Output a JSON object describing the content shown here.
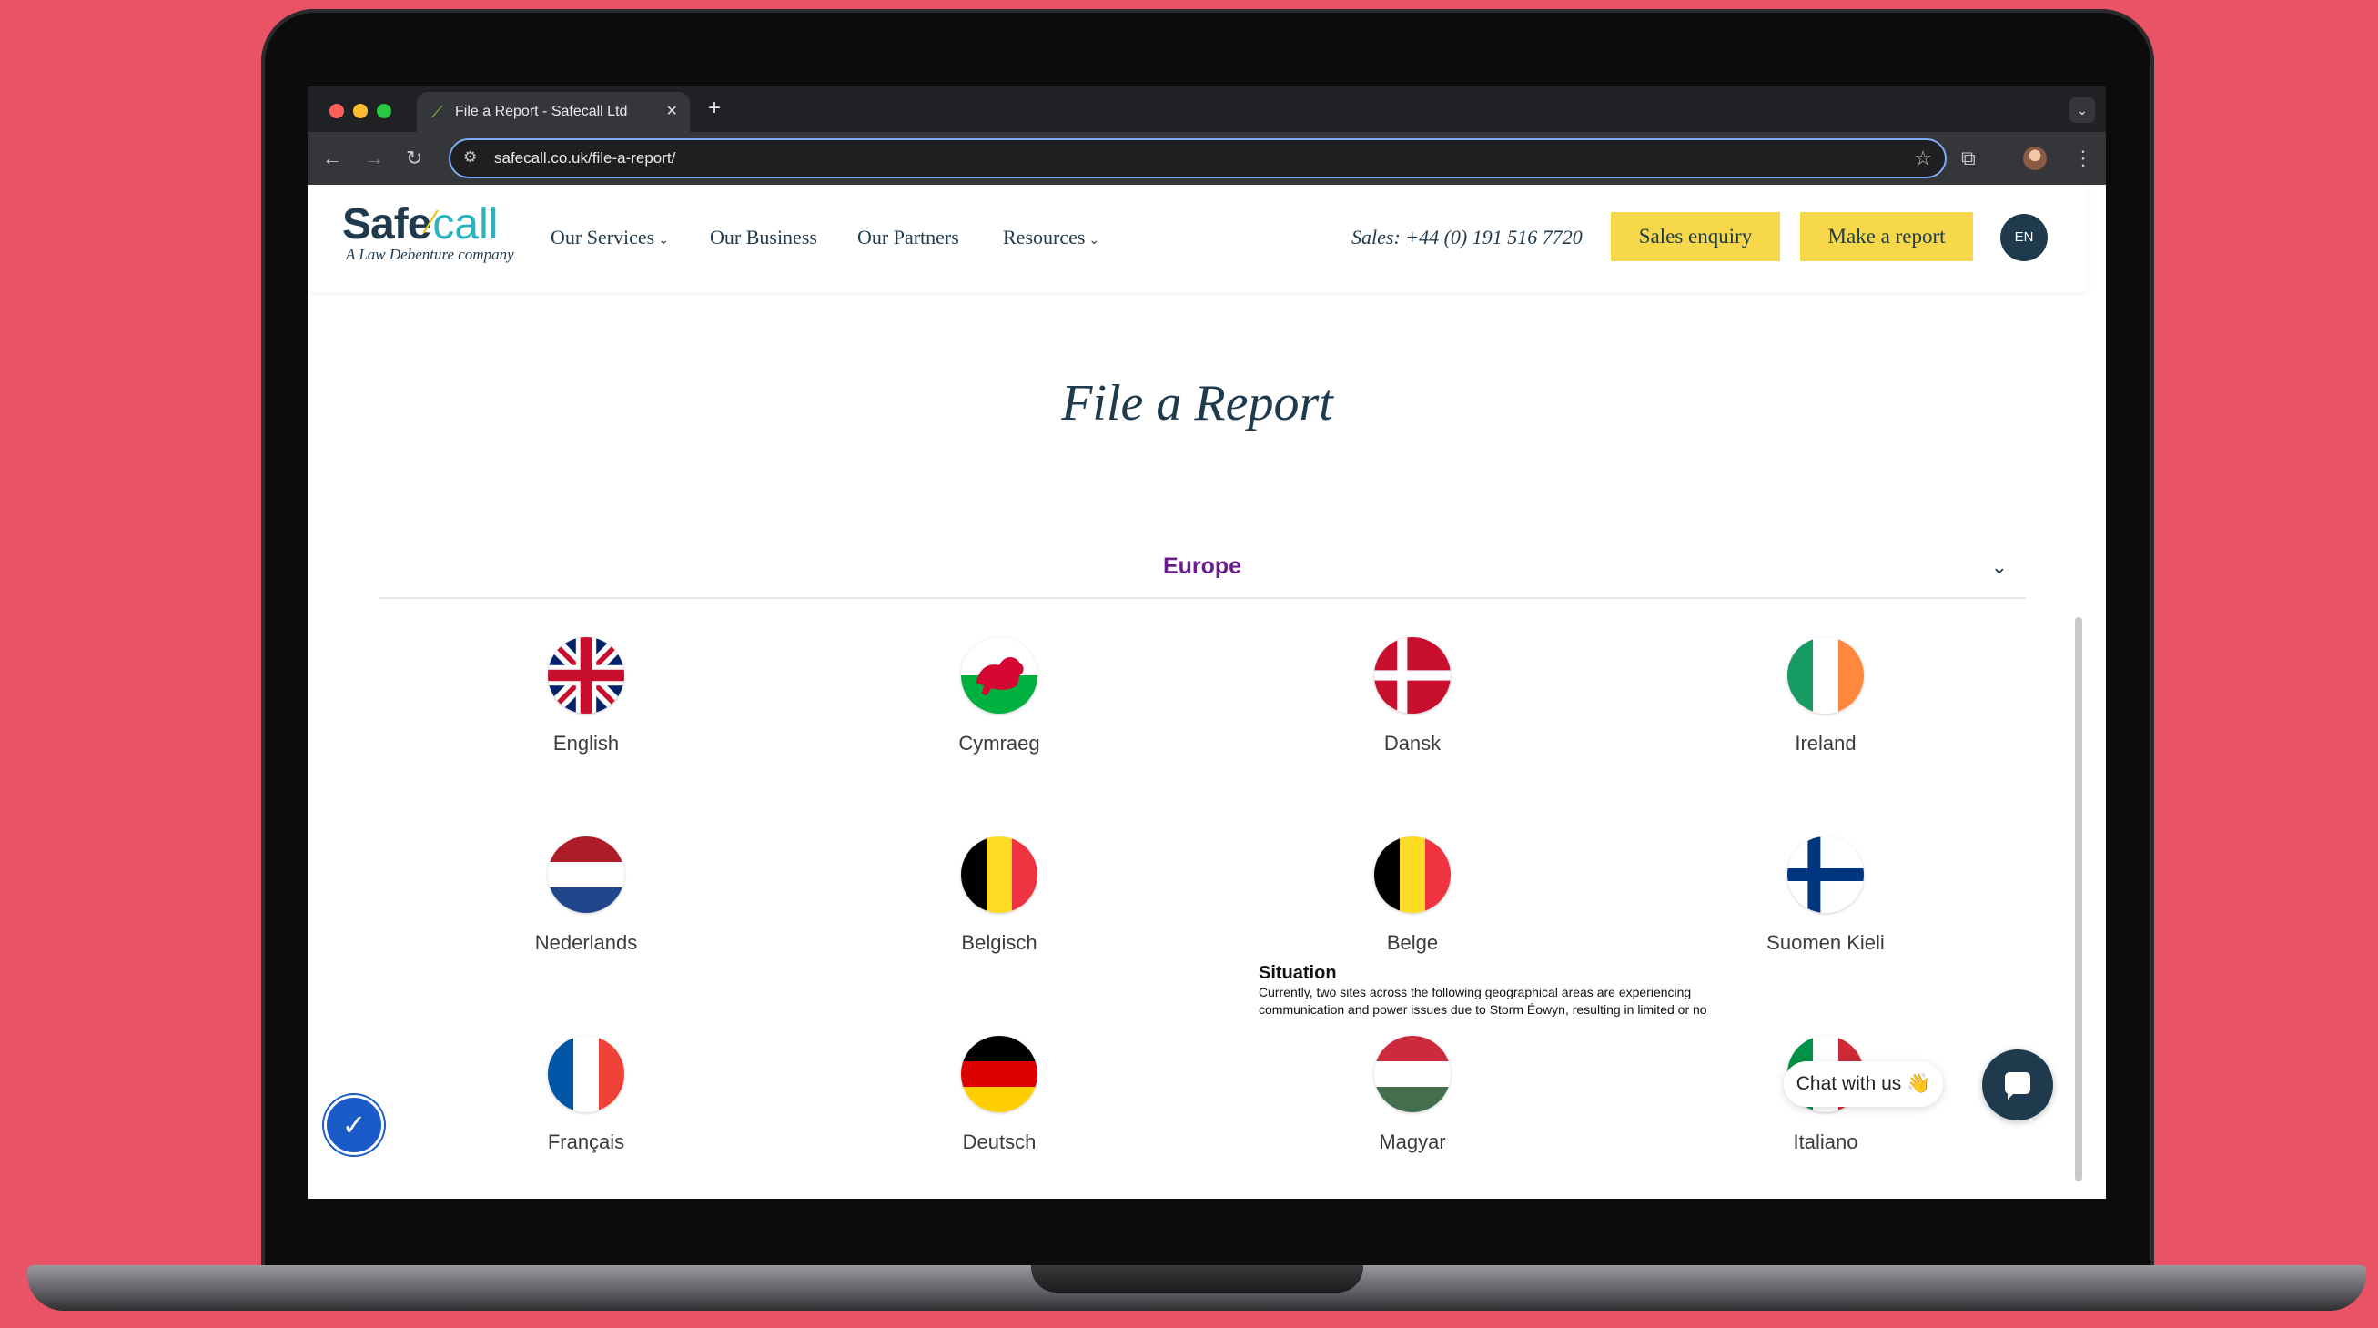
{
  "browser": {
    "tab_title": "File a Report - Safecall Ltd",
    "tab_close": "×",
    "new_tab": "+",
    "url": "safecall.co.uk/file-a-report/"
  },
  "site": {
    "logo": {
      "safe": "Safe",
      "call": "call",
      "tagline": "A Law Debenture company"
    },
    "nav": {
      "services": "Our Services",
      "business": "Our Business",
      "partners": "Our Partners",
      "resources": "Resources"
    },
    "sales_phone": "Sales: +44 (0) 191 516 7720",
    "sales_enquiry": "Sales enquiry",
    "make_report": "Make a report",
    "language": "EN"
  },
  "page": {
    "title": "File a Report",
    "region": "Europe",
    "languages": [
      {
        "label": "English",
        "flag": "uk-flag"
      },
      {
        "label": "Cymraeg",
        "flag": "wales-flag"
      },
      {
        "label": "Dansk",
        "flag": "denmark-flag"
      },
      {
        "label": "Ireland",
        "flag": "ireland-flag"
      },
      {
        "label": "Nederlands",
        "flag": "netherlands-flag"
      },
      {
        "label": "Belgisch",
        "flag": "belgium-flag"
      },
      {
        "label": "Belge",
        "flag": "belgium-flag"
      },
      {
        "label": "Suomen Kieli",
        "flag": "finland-flag"
      },
      {
        "label": "Français",
        "flag": "france-flag"
      },
      {
        "label": "Deutsch",
        "flag": "germany-flag"
      },
      {
        "label": "Magyar",
        "flag": "hungary-flag"
      },
      {
        "label": "Italiano",
        "flag": "italy-flag"
      }
    ]
  },
  "situation": {
    "heading": "Situation",
    "line1": "Currently, two sites across the following geographical areas are experiencing",
    "line2": "communication and power issues due to Storm Éowyn, resulting in limited or no"
  },
  "chat": {
    "label": "Chat with us 👋"
  },
  "colors": {
    "background": "#e85466",
    "brand_navy": "#1f3a4d",
    "brand_yellow": "#f6d84a",
    "region_purple": "#6b1d8e"
  }
}
